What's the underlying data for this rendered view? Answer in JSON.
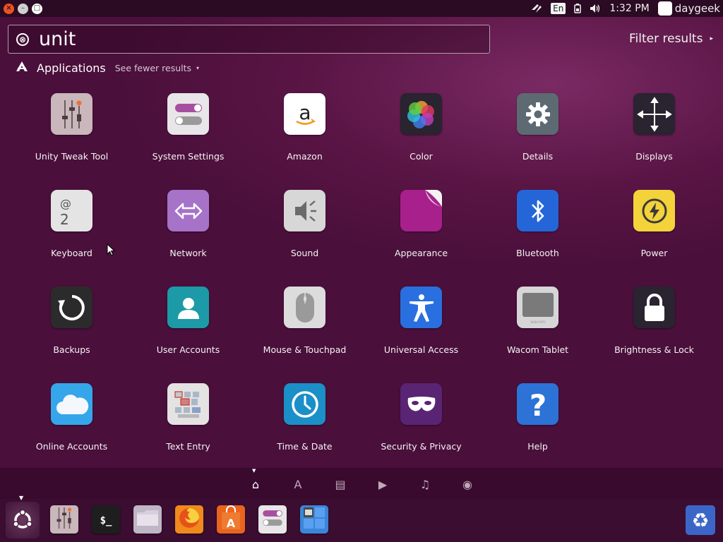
{
  "top_panel": {
    "window_buttons": {
      "close": "×",
      "minimize": "–",
      "maximize": "□"
    },
    "keyboard_layout": "En",
    "time": "1:32 PM",
    "user": "daygeek",
    "icons": [
      "transfer-icon",
      "keyboard-layout-icon",
      "battery-icon",
      "volume-icon"
    ]
  },
  "search": {
    "value": "unit",
    "clear_icon": "⊗"
  },
  "filter": {
    "label": "Filter results",
    "arrow": "▸"
  },
  "category": {
    "title": "Applications",
    "toggle_label": "See fewer results",
    "toggle_arrow": "▾"
  },
  "apps": [
    {
      "label": "Unity Tweak Tool",
      "icon": "sliders-icon",
      "color": "#c9b7bb"
    },
    {
      "label": "System Settings",
      "icon": "toggle-switches-icon",
      "color": "#e8e6e8"
    },
    {
      "label": "Amazon",
      "icon": "amazon-icon",
      "color": "#ffffff"
    },
    {
      "label": "Color",
      "icon": "color-wheel-icon",
      "color": "#2a2330"
    },
    {
      "label": "Details",
      "icon": "gear-icon",
      "color": "#5d6a72"
    },
    {
      "label": "Displays",
      "icon": "display-arrows-icon",
      "color": "#2a2330"
    },
    {
      "label": "Keyboard",
      "icon": "keyboard-keys-icon",
      "color": "#e4e4e4"
    },
    {
      "label": "Network",
      "icon": "network-arrows-icon",
      "color": "#a673c9"
    },
    {
      "label": "Sound",
      "icon": "speaker-icon",
      "color": "#d7d7d7"
    },
    {
      "label": "Appearance",
      "icon": "page-curl-icon",
      "color": "#a8208b"
    },
    {
      "label": "Bluetooth",
      "icon": "bluetooth-icon",
      "color": "#2466d8"
    },
    {
      "label": "Power",
      "icon": "power-bolt-icon",
      "color": "#f4d23a"
    },
    {
      "label": "Backups",
      "icon": "backup-circle-icon",
      "color": "#2b2b2b"
    },
    {
      "label": "User Accounts",
      "icon": "user-icon",
      "color": "#1d9aa7"
    },
    {
      "label": "Mouse & Touchpad",
      "icon": "mouse-icon",
      "color": "#dcdcdc"
    },
    {
      "label": "Universal Access",
      "icon": "accessibility-icon",
      "color": "#2a6fe0"
    },
    {
      "label": "Wacom Tablet",
      "icon": "tablet-icon",
      "color": "#d6d6d6"
    },
    {
      "label": "Brightness & Lock",
      "icon": "lock-icon",
      "color": "#2a2330"
    },
    {
      "label": "Online Accounts",
      "icon": "cloud-icon",
      "color": "#35a6ea"
    },
    {
      "label": "Text Entry",
      "icon": "text-entry-keys-icon",
      "color": "#e4e2e2"
    },
    {
      "label": "Time & Date",
      "icon": "clock-icon",
      "color": "#1b8fc8"
    },
    {
      "label": "Security & Privacy",
      "icon": "mask-icon",
      "color": "#5a2474"
    },
    {
      "label": "Help",
      "icon": "question-icon",
      "color": "#2d72d6"
    }
  ],
  "lenses": [
    {
      "name": "home-lens-icon",
      "glyph": "⌂",
      "active": true
    },
    {
      "name": "applications-lens-icon",
      "glyph": "A",
      "active": false
    },
    {
      "name": "files-lens-icon",
      "glyph": "▤",
      "active": false
    },
    {
      "name": "video-lens-icon",
      "glyph": "▶",
      "active": false
    },
    {
      "name": "music-lens-icon",
      "glyph": "♫",
      "active": false
    },
    {
      "name": "photos-lens-icon",
      "glyph": "◉",
      "active": false
    }
  ],
  "launcher": {
    "items": [
      {
        "name": "unity-tweak-tool-launcher",
        "icon": "sliders-icon",
        "color": "#c9b7bb"
      },
      {
        "name": "terminal-launcher",
        "icon": "terminal-icon",
        "glyph": "$_",
        "color": "#1e1e1e"
      },
      {
        "name": "files-launcher",
        "icon": "folder-icon",
        "color": "#bfb6c6"
      },
      {
        "name": "firefox-launcher",
        "icon": "firefox-icon",
        "color": "#f08a1c"
      },
      {
        "name": "software-center-launcher",
        "icon": "shopping-bag-icon",
        "glyph": "A",
        "color": "#e8641f"
      },
      {
        "name": "system-settings-launcher",
        "icon": "toggle-switches-icon",
        "color": "#e8e6e8"
      },
      {
        "name": "workspace-switcher-launcher",
        "icon": "workspaces-icon",
        "color": "#3b86d9"
      }
    ],
    "trash_icon": "recycle-icon",
    "trash_glyph": "♻"
  }
}
